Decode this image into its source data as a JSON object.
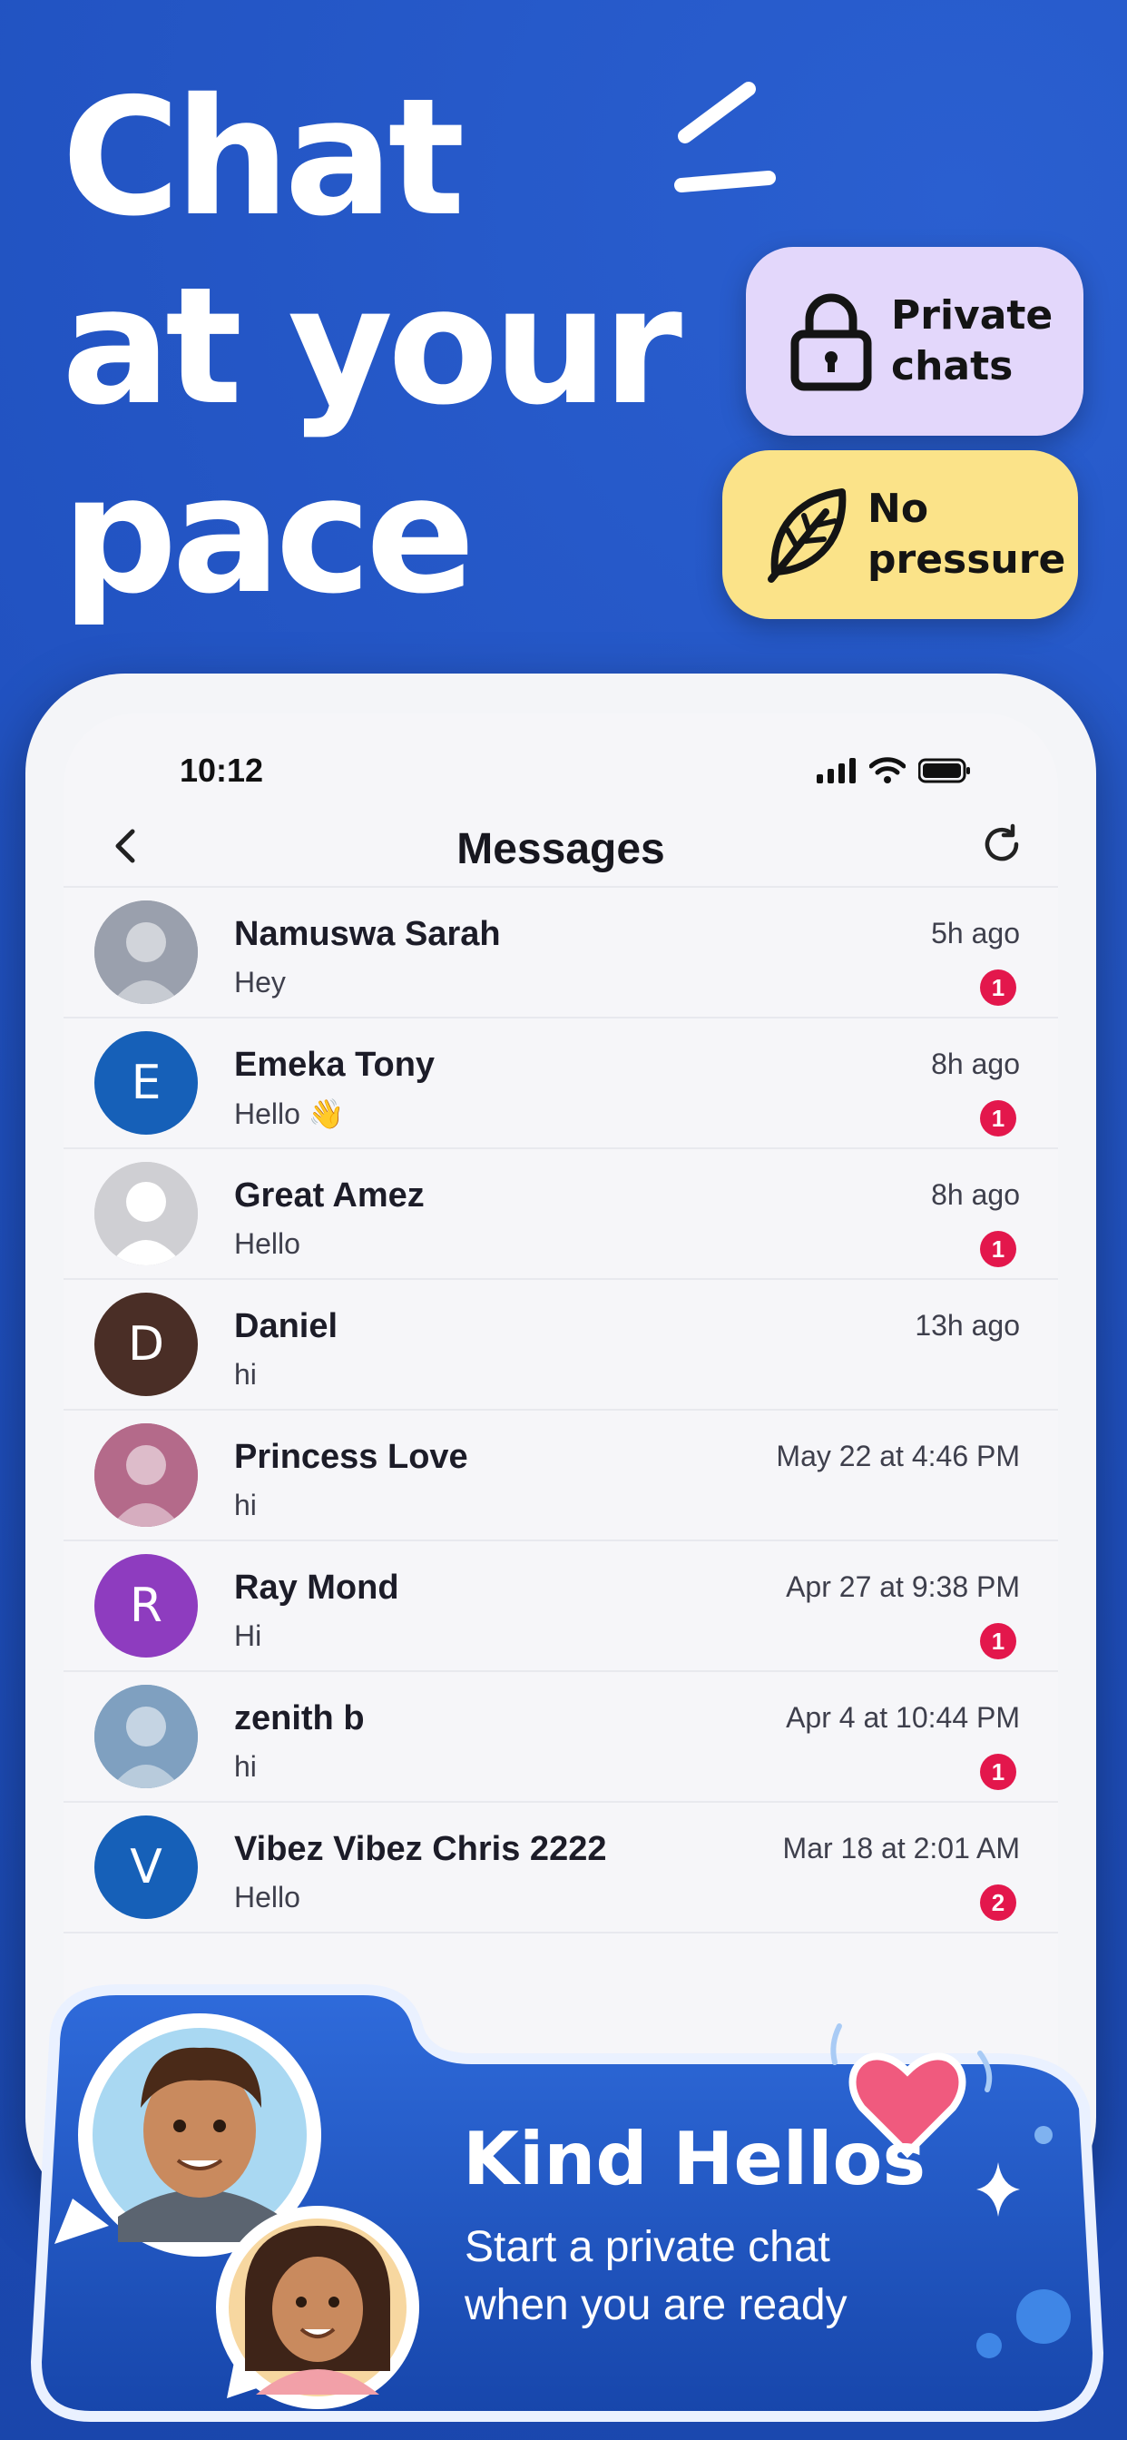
{
  "hero": {
    "title_lines": [
      "Chat",
      "at your",
      "pace"
    ]
  },
  "pills": {
    "private": {
      "label": "Private chats",
      "icon": "lock-icon",
      "color": "#e3d7fb"
    },
    "no_pressure": {
      "label": "No pressure",
      "icon": "leaf-icon",
      "color": "#fbe389"
    }
  },
  "phone": {
    "status_time": "10:12",
    "nav_title": "Messages",
    "conversations": [
      {
        "name": "Namuswa Sarah",
        "message": "Hey",
        "time": "5h ago",
        "unread": "1",
        "avatar": "photo",
        "color": "#9aa0ad"
      },
      {
        "name": "Emeka Tony",
        "message": "Hello 👋",
        "time": "8h ago",
        "unread": "1",
        "avatar": "E",
        "color": "#1660b8"
      },
      {
        "name": "Great Amez",
        "message": "Hello",
        "time": "8h ago",
        "unread": "1",
        "avatar": "default-user",
        "color": "#cfcfd3"
      },
      {
        "name": "Daniel",
        "message": "hi",
        "time": "13h ago",
        "unread": "",
        "avatar": "D",
        "color": "#4a2e26"
      },
      {
        "name": "Princess Love",
        "message": "hi",
        "time": "May 22 at 4:46 PM",
        "unread": "",
        "avatar": "photo",
        "color": "#b46a8a"
      },
      {
        "name": "Ray Mond",
        "message": "Hi",
        "time": "Apr 27 at 9:38 PM",
        "unread": "1",
        "avatar": "R",
        "color": "#8e3cbf"
      },
      {
        "name": "zenith b",
        "message": "hi",
        "time": "Apr 4 at 10:44 PM",
        "unread": "1",
        "avatar": "photo",
        "color": "#7fa0c0"
      },
      {
        "name": "Vibez Vibez Chris 2222",
        "message": "Hello",
        "time": "Mar 18 at 2:01 AM",
        "unread": "2",
        "avatar": "V",
        "color": "#1660b8"
      }
    ]
  },
  "promo": {
    "title": "Kind Hellos",
    "subtitle": "Start a private chat when you are ready"
  },
  "colors": {
    "background": "#1f4fbd",
    "badge": "#e3174c",
    "heart": "#f05a7e"
  }
}
